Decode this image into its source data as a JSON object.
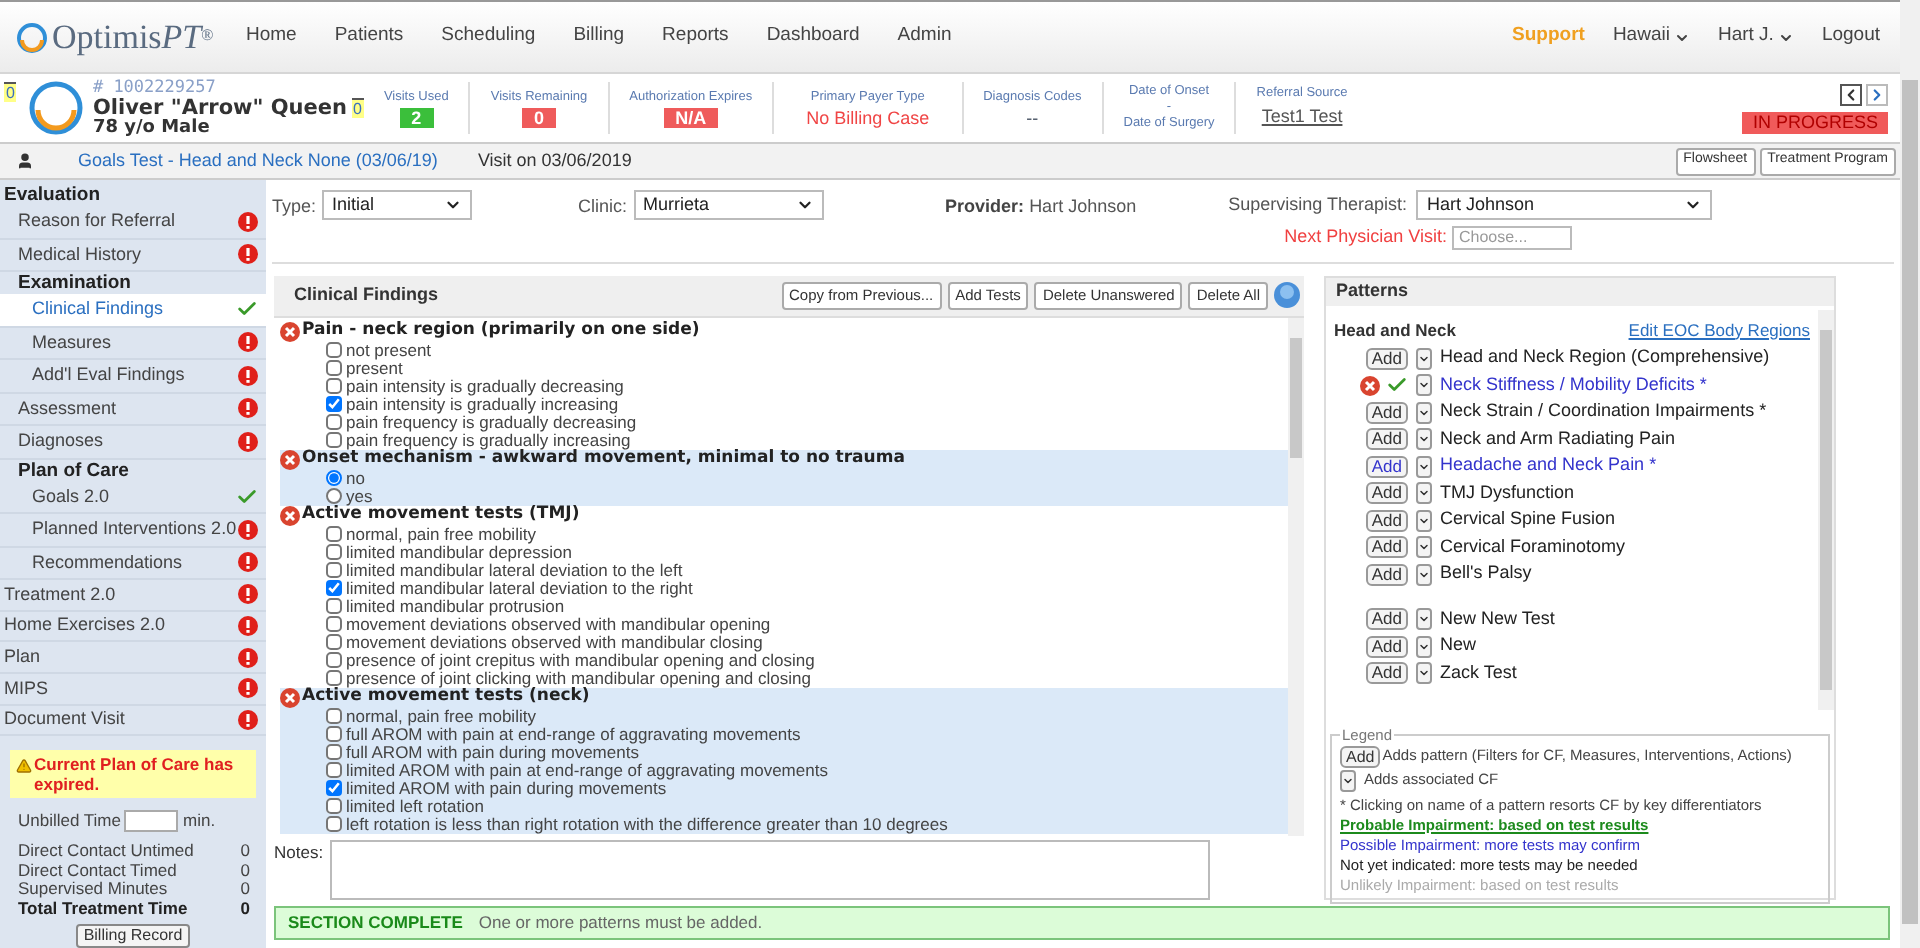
{
  "nav": {
    "logo": {
      "name": "Optimis",
      "suffix": "PT",
      "mark": "®"
    },
    "menu": [
      "Home",
      "Patients",
      "Scheduling",
      "Billing",
      "Reports",
      "Dashboard",
      "Admin"
    ],
    "support": "Support",
    "location": "Hawaii",
    "user": "Hart J.",
    "logout": "Logout"
  },
  "patient": {
    "left_badge": "0",
    "id": "# 1002229257",
    "name": "Oliver \"Arrow\" Queen",
    "age_sex": "78 y/o Male",
    "badge": "0",
    "stats": [
      {
        "label": "Visits Used",
        "value": "2",
        "kind": "ok"
      },
      {
        "label": "Visits Remaining",
        "value": "0",
        "kind": "alert"
      },
      {
        "label": "Authorization Expires",
        "value": "N/A",
        "kind": "alert"
      },
      {
        "label": "Primary Payer Type",
        "value": "No Billing Case",
        "kind": "warning"
      },
      {
        "label": "Diagnosis Codes",
        "value": "--",
        "kind": "plain"
      }
    ],
    "dates": {
      "onset": "Date of Onset",
      "separator": "-",
      "surgery": "Date of Surgery"
    },
    "referral": {
      "label": "Referral Source",
      "value": "Test1 Test"
    },
    "status": "IN PROGRESS"
  },
  "breadcrumb": {
    "items": [
      "Goals Test - Head and Neck None (03/06/19)",
      "Visit on 03/06/2019"
    ],
    "buttons": [
      "Flowsheet",
      "Treatment Program"
    ]
  },
  "sidebar": {
    "items": [
      {
        "label": "Evaluation",
        "children": [
          {
            "label": "Reason for Referral",
            "complete": false,
            "selected": false
          },
          {
            "label": "Medical History",
            "complete": false,
            "selected": false
          },
          {
            "label": "Examination",
            "children": [
              {
                "label": "Clinical Findings",
                "complete": true,
                "selected": true
              },
              {
                "label": "Measures",
                "complete": false,
                "selected": false
              },
              {
                "label": "Add'l Eval Findings",
                "complete": false,
                "selected": false
              }
            ]
          },
          {
            "label": "Assessment",
            "complete": false,
            "selected": false
          },
          {
            "label": "Diagnoses",
            "complete": false,
            "selected": false
          },
          {
            "label": "Plan of Care",
            "children": [
              {
                "label": "Goals 2.0",
                "complete": true,
                "selected": false
              },
              {
                "label": "Planned Interventions 2.0",
                "complete": false,
                "selected": false
              },
              {
                "label": "Recommendations",
                "complete": false,
                "selected": false
              }
            ]
          }
        ]
      },
      {
        "label": "Treatment 2.0",
        "complete": false,
        "selected": false
      },
      {
        "label": "Home Exercises 2.0",
        "complete": false,
        "selected": false
      },
      {
        "label": "Plan",
        "complete": false,
        "selected": false
      },
      {
        "label": "MIPS",
        "complete": false,
        "selected": false
      },
      {
        "label": "Document Visit",
        "complete": false,
        "selected": false
      }
    ],
    "alert": "Current Plan of Care has expired.",
    "unbilled": {
      "label": "Unbilled Time",
      "unit": "min."
    },
    "totals": [
      {
        "label": "Direct Contact Untimed",
        "value": "0",
        "bold": false
      },
      {
        "label": "Direct Contact Timed",
        "value": "0",
        "bold": false
      },
      {
        "label": "Supervised Minutes",
        "value": "0",
        "bold": false
      },
      {
        "label": "Total Treatment Time",
        "value": "0",
        "bold": true
      }
    ],
    "button": "Billing Record"
  },
  "form": {
    "type": {
      "label": "Type:",
      "value": "Initial"
    },
    "clinic": {
      "label": "Clinic:",
      "value": "Murrieta"
    },
    "provider": {
      "label": "Provider:",
      "value": "Hart Johnson"
    },
    "supervising": {
      "label": "Supervising Therapist:",
      "value": "Hart Johnson"
    },
    "next_visit": {
      "label": "Next Physician Visit:",
      "placeholder": "Choose..."
    }
  },
  "findings": {
    "title": "Clinical Findings",
    "buttons": [
      "Copy from Previous...",
      "Add Tests",
      "Delete Unanswered",
      "Delete All"
    ],
    "groups": [
      {
        "title": "Pain - neck region (primarily on one side)",
        "kind": "checkbox",
        "highlighted": false,
        "items": [
          {
            "label": "not present",
            "checked": false
          },
          {
            "label": "present",
            "checked": false
          },
          {
            "label": "pain intensity is gradually decreasing",
            "checked": false
          },
          {
            "label": "pain intensity is gradually increasing",
            "checked": true
          },
          {
            "label": "pain frequency is gradually decreasing",
            "checked": false
          },
          {
            "label": "pain frequency is gradually increasing",
            "checked": false
          }
        ]
      },
      {
        "title": "Onset mechanism - awkward movement, minimal to no trauma",
        "kind": "radio",
        "highlighted": true,
        "items": [
          {
            "label": "no",
            "selected": true
          },
          {
            "label": "yes",
            "selected": false
          }
        ]
      },
      {
        "title": "Active movement tests (TMJ)",
        "kind": "checkbox",
        "highlighted": false,
        "items": [
          {
            "label": "normal, pain free mobility",
            "checked": false
          },
          {
            "label": "limited mandibular depression",
            "checked": false
          },
          {
            "label": "limited mandibular lateral deviation to the left",
            "checked": false
          },
          {
            "label": "limited mandibular lateral deviation to the right",
            "checked": true
          },
          {
            "label": "limited mandibular protrusion",
            "checked": false
          },
          {
            "label": "movement deviations observed with mandibular opening",
            "checked": false
          },
          {
            "label": "movement deviations observed with mandibular closing",
            "checked": false
          },
          {
            "label": "presence of joint crepitus with mandibular opening and closing",
            "checked": false
          },
          {
            "label": "presence of joint clicking with mandibular opening and closing",
            "checked": false
          }
        ]
      },
      {
        "title": "Active movement tests (neck)",
        "kind": "checkbox",
        "highlighted": true,
        "items": [
          {
            "label": "normal, pain free mobility",
            "checked": false
          },
          {
            "label": "full AROM with pain at end-range of aggravating movements",
            "checked": false
          },
          {
            "label": "full AROM with pain during movements",
            "checked": false
          },
          {
            "label": "limited AROM with pain at end-range of aggravating movements",
            "checked": false
          },
          {
            "label": "limited AROM with pain during movements",
            "checked": true
          },
          {
            "label": "limited left rotation",
            "checked": false
          },
          {
            "label": "left rotation is less than right rotation with the difference greater than 10 degrees",
            "checked": false
          }
        ]
      }
    ],
    "notes_label": "Notes:"
  },
  "section": {
    "status": "SECTION COMPLETE",
    "message": "One or more patterns must be added."
  },
  "patterns": {
    "title": "Patterns",
    "region": "Head and Neck",
    "edit_link": "Edit EOC Body Regions",
    "groups": [
      {
        "items": [
          {
            "label": "Head and Neck Region (Comprehensive)",
            "kind": "pending",
            "added": false,
            "button": "Add"
          },
          {
            "label": "Neck Stiffness / Mobility Deficits *",
            "kind": "possible",
            "added": true
          },
          {
            "label": "Neck Strain / Coordination Impairments *",
            "kind": "pending",
            "added": false,
            "button": "Add"
          },
          {
            "label": "Neck and Arm Radiating Pain",
            "kind": "pending",
            "added": false,
            "button": "Add"
          },
          {
            "label": "Headache and Neck Pain *",
            "kind": "possible",
            "added": false,
            "button": "Add"
          },
          {
            "label": "TMJ Dysfunction",
            "kind": "pending",
            "added": false,
            "button": "Add"
          },
          {
            "label": "Cervical Spine Fusion",
            "kind": "pending",
            "added": false,
            "button": "Add"
          },
          {
            "label": "Cervical Foraminotomy",
            "kind": "pending",
            "added": false,
            "button": "Add"
          },
          {
            "label": "Bell's Palsy",
            "kind": "pending",
            "added": false,
            "button": "Add"
          }
        ]
      },
      {
        "items": [
          {
            "label": "New New Test",
            "kind": "pending",
            "added": false,
            "button": "Add"
          },
          {
            "label": "New",
            "kind": "pending",
            "added": false,
            "button": "Add"
          },
          {
            "label": "Zack Test",
            "kind": "pending",
            "added": false,
            "button": "Add"
          }
        ]
      }
    ],
    "legend": {
      "title": "Legend",
      "add_button": "Add",
      "add_text": "Adds pattern (Filters for CF, Measures, Interventions, Actions)",
      "cf_text": "Adds associated CF",
      "note": "* Clicking on name of a pattern resorts CF by key differentiators",
      "statuses": [
        {
          "label": "Probable Impairment: based on test results",
          "kind": "probable"
        },
        {
          "label": "Possible Impairment: more tests may confirm",
          "kind": "possible"
        },
        {
          "label": "Not yet indicated: more tests may be needed",
          "kind": "pending"
        },
        {
          "label": "Unlikely Impairment: based on test results",
          "kind": "unlikely"
        }
      ]
    }
  }
}
